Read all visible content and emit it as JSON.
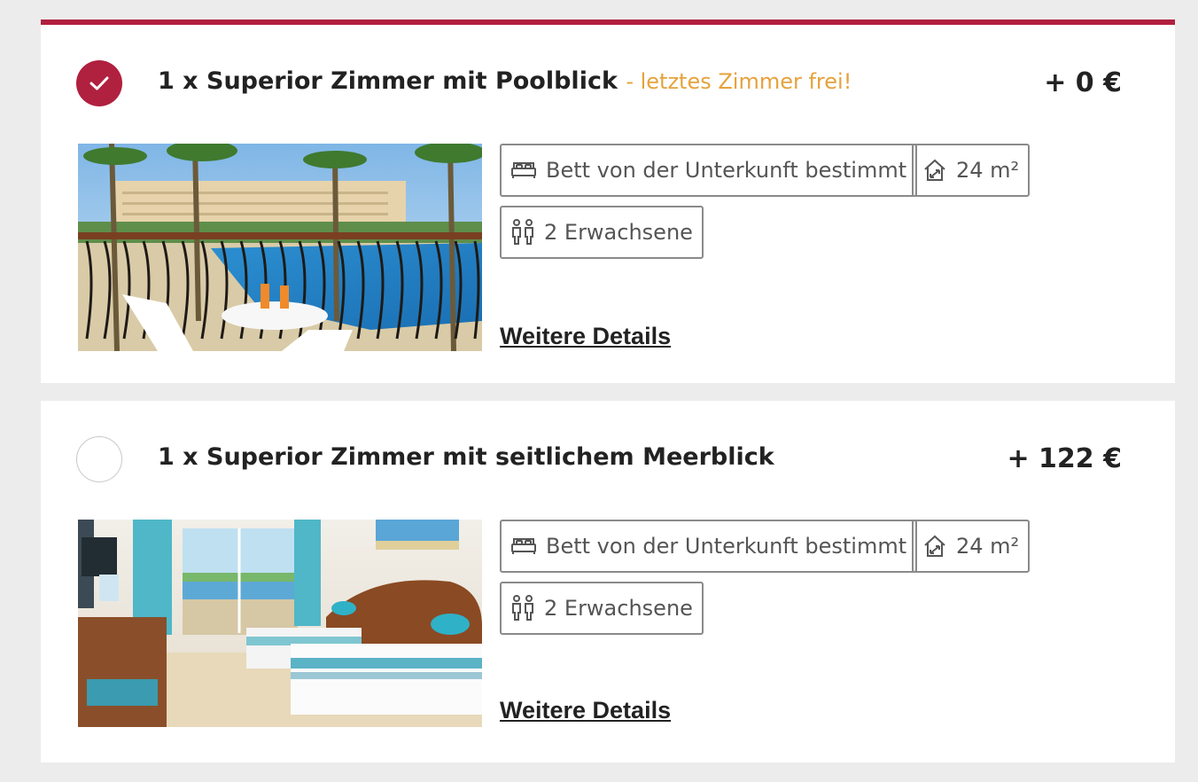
{
  "colors": {
    "accent": "#b0203f",
    "badge": "#e6a23c",
    "chip_border": "#8a8a8a",
    "background": "#ececec"
  },
  "rooms": [
    {
      "selected": true,
      "title": "1 x Superior Zimmer mit Poolblick",
      "badge": "- letztes Zimmer frei!",
      "price": "+ 0 €",
      "bed": "Bett von der Unterkunft bestimmt",
      "size": "24 m²",
      "guests": "2 Erwachsene",
      "details_link": "Weitere Details",
      "image": "pool-balcony-photo"
    },
    {
      "selected": false,
      "title": "1 x Superior Zimmer mit seitlichem Meerblick",
      "badge": "",
      "price": "+ 122 €",
      "bed": "Bett von der Unterkunft bestimmt",
      "size": "24 m²",
      "guests": "2 Erwachsene",
      "details_link": "Weitere Details",
      "image": "twin-bedroom-photo"
    }
  ],
  "icons": {
    "check": "checkmark-icon",
    "bed": "bed-icon",
    "size": "room-size-icon",
    "guests": "adults-icon"
  }
}
